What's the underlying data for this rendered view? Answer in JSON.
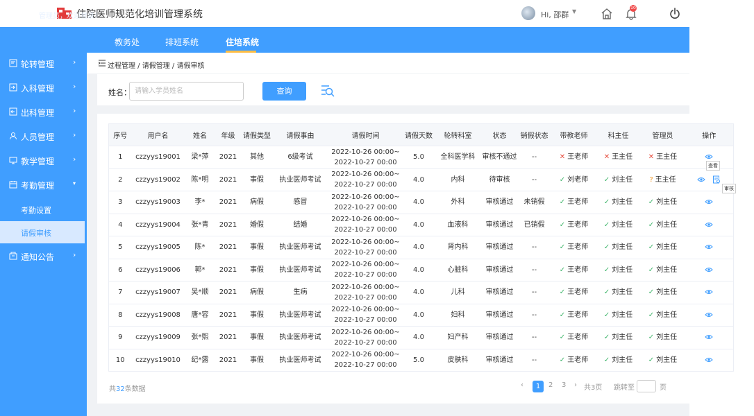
{
  "header": {
    "app_title": "住院医师规范化培训管理系统",
    "greeting": "Hi,  邵群",
    "notification_count": "10"
  },
  "nav": {
    "user_name": "邵群",
    "welcome": "管理员，欢迎登录！",
    "tabs": [
      {
        "label": "教务处"
      },
      {
        "label": "排班系统"
      },
      {
        "label": "住培系统"
      }
    ]
  },
  "sidebar": {
    "items": [
      {
        "label": "轮转管理"
      },
      {
        "label": "入科管理"
      },
      {
        "label": "出科管理"
      },
      {
        "label": "人员管理"
      },
      {
        "label": "教学管理"
      },
      {
        "label": "考勤管理"
      },
      {
        "label": "考勤设置"
      },
      {
        "label": "请假审核"
      },
      {
        "label": "通知公告"
      }
    ]
  },
  "breadcrumb": "过程管理 / 请假管理 / 请假审核",
  "search": {
    "label": "姓名：",
    "placeholder": "请输入学员姓名",
    "button": "查询"
  },
  "table": {
    "headers": [
      "序号",
      "用户名",
      "姓名",
      "年级",
      "请假类型",
      "请假事由",
      "请假时间",
      "请假天数",
      "轮转科室",
      "状态",
      "销假状态",
      "带教老师",
      "科主任",
      "管理员",
      "操作"
    ],
    "rows": [
      {
        "no": "1",
        "user": "czzyys19001",
        "name": "梁*萍",
        "grade": "2021",
        "type": "其他",
        "reason": "6级考试",
        "t1": "2022-10-26 00:00~",
        "t2": "2022-10-27 00:00",
        "days": "5.0",
        "dept": "全科医学科",
        "status": "审核不通过",
        "cancel": "--",
        "teacher": "王老师",
        "director": "王主任",
        "admin": "王主任"
      },
      {
        "no": "2",
        "user": "czzyys19002",
        "name": "陈*明",
        "grade": "2021",
        "type": "事假",
        "reason": "执业医师考试",
        "t1": "2022-10-26 00:00~",
        "t2": "2022-10-27 00:00",
        "days": "4.0",
        "dept": "内科",
        "status": "待审核",
        "cancel": "--",
        "teacher": "刘老师",
        "director": "刘主任",
        "admin": "王主任"
      },
      {
        "no": "3",
        "user": "czzyys19003",
        "name": "李*",
        "grade": "2021",
        "type": "病假",
        "reason": "感冒",
        "t1": "2022-10-26 00:00~",
        "t2": "2022-10-27 00:00",
        "days": "4.0",
        "dept": "外科",
        "status": "审核通过",
        "cancel": "未销假",
        "teacher": "王老师",
        "director": "刘主任",
        "admin": "刘主任"
      },
      {
        "no": "4",
        "user": "czzyys19004",
        "name": "张*青",
        "grade": "2021",
        "type": "婚假",
        "reason": "结婚",
        "t1": "2022-10-26 00:00~",
        "t2": "2022-10-27 00:00",
        "days": "4.0",
        "dept": "血液科",
        "status": "审核通过",
        "cancel": "已销假",
        "teacher": "王老师",
        "director": "刘主任",
        "admin": "刘主任"
      },
      {
        "no": "5",
        "user": "czzyys19005",
        "name": "陈*",
        "grade": "2021",
        "type": "事假",
        "reason": "执业医师考试",
        "t1": "2022-10-26 00:00~",
        "t2": "2022-10-27 00:00",
        "days": "4.0",
        "dept": "肾内科",
        "status": "审核通过",
        "cancel": "--",
        "teacher": "王老师",
        "director": "刘主任",
        "admin": "刘主任"
      },
      {
        "no": "6",
        "user": "czzyys19006",
        "name": "郭*",
        "grade": "2021",
        "type": "事假",
        "reason": "执业医师考试",
        "t1": "2022-10-26 00:00~",
        "t2": "2022-10-27 00:00",
        "days": "4.0",
        "dept": "心脏科",
        "status": "审核通过",
        "cancel": "--",
        "teacher": "王老师",
        "director": "刘主任",
        "admin": "刘主任"
      },
      {
        "no": "7",
        "user": "czzyys19007",
        "name": "吴*顺",
        "grade": "2021",
        "type": "病假",
        "reason": "生病",
        "t1": "2022-10-26 00:00~",
        "t2": "2022-10-27 00:00",
        "days": "4.0",
        "dept": "儿科",
        "status": "审核通过",
        "cancel": "--",
        "teacher": "王老师",
        "director": "刘主任",
        "admin": "刘主任"
      },
      {
        "no": "8",
        "user": "czzyys19008",
        "name": "唐*容",
        "grade": "2021",
        "type": "事假",
        "reason": "执业医师考试",
        "t1": "2022-10-26 00:00~",
        "t2": "2022-10-27 00:00",
        "days": "4.0",
        "dept": "妇科",
        "status": "审核通过",
        "cancel": "--",
        "teacher": "王老师",
        "director": "刘主任",
        "admin": "刘主任"
      },
      {
        "no": "9",
        "user": "czzyys19009",
        "name": "张*熙",
        "grade": "2021",
        "type": "事假",
        "reason": "执业医师考试",
        "t1": "2022-10-26 00:00~",
        "t2": "2022-10-27 00:00",
        "days": "4.0",
        "dept": "妇产科",
        "status": "审核通过",
        "cancel": "--",
        "teacher": "王老师",
        "director": "刘主任",
        "admin": "刘主任"
      },
      {
        "no": "10",
        "user": "czzyys19010",
        "name": "纪*露",
        "grade": "2021",
        "type": "事假",
        "reason": "执业医师考试",
        "t1": "2022-10-26 00:00~",
        "t2": "2022-10-27 00:00",
        "days": "5.0",
        "dept": "皮肤科",
        "status": "审核通过",
        "cancel": "--",
        "teacher": "王老师",
        "director": "刘主任",
        "admin": "刘主任"
      }
    ],
    "tooltips": {
      "view": "查看",
      "review": "审核"
    }
  },
  "pagination": {
    "total_prefix": "共",
    "total_count": "32",
    "total_suffix": "条数据",
    "prev": "‹",
    "pages": [
      "1",
      "2",
      "3"
    ],
    "next": "›",
    "page_count": "共3页",
    "jump_label": "跳转至",
    "page_unit": "页"
  },
  "colors": {
    "accent": "#409eff",
    "ok": "#3fb56a",
    "reject": "#e64b3b",
    "pending": "#f29b2b"
  }
}
